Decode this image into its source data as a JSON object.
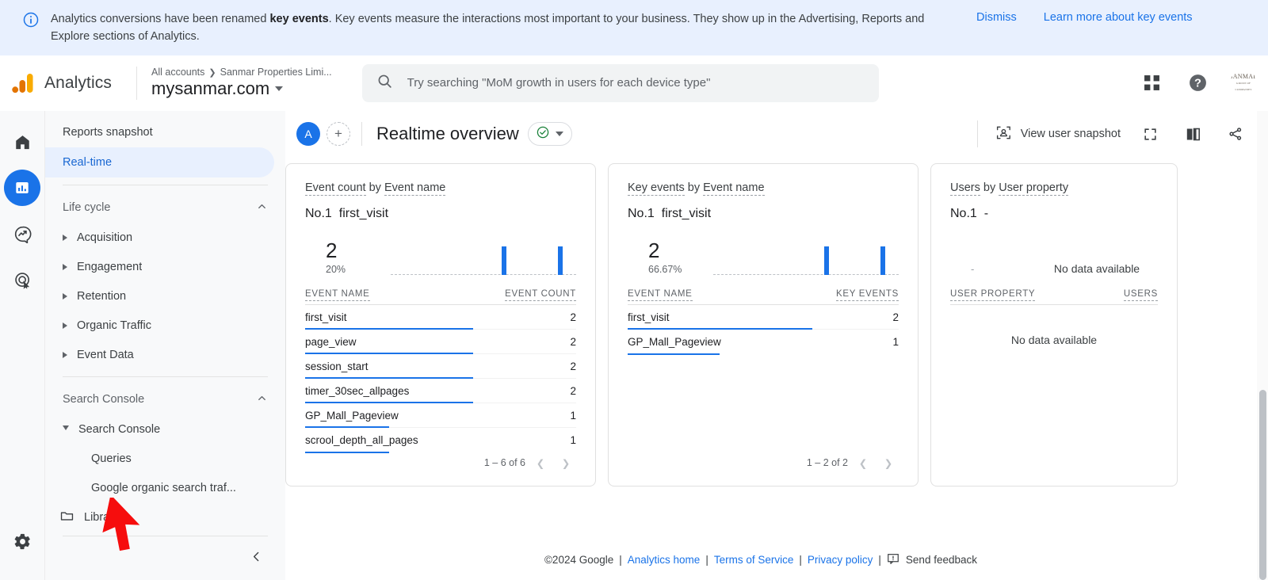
{
  "banner": {
    "icon": "info-icon",
    "text_before": "Analytics conversions have been renamed ",
    "bold": "key events",
    "text_after": ". Key events measure the interactions most important to your business. They show up in the Advertising, Reports and Explore sections of Analytics.",
    "dismiss_label": "Dismiss",
    "learn_more_label": "Learn more about key events"
  },
  "topbar": {
    "product_title": "Analytics",
    "breadcrumb_root": "All accounts",
    "breadcrumb_account": "Sanmar Properties Limi...",
    "property_name": "mysanmar.com",
    "search_placeholder": "Try searching \"MoM growth in users for each device type\"",
    "apps_icon": "apps-grid-icon",
    "help_icon": "help-circle-icon",
    "avatar_label": "SANMAR",
    "avatar_sub": "GROUP OF COMPANIES"
  },
  "rail": {
    "items": [
      {
        "name": "home-icon",
        "label": "Home",
        "active": false
      },
      {
        "name": "reports-icon",
        "label": "Reports",
        "active": true
      },
      {
        "name": "explore-icon",
        "label": "Explore",
        "active": false
      },
      {
        "name": "advertising-icon",
        "label": "Advertising",
        "active": false
      }
    ],
    "settings": {
      "name": "gear-icon",
      "label": "Admin"
    }
  },
  "sidebar": {
    "reports_snapshot": "Reports snapshot",
    "realtime": "Real-time",
    "life_cycle": "Life cycle",
    "life_cycle_items": [
      "Acquisition",
      "Engagement",
      "Retention",
      "Organic Traffic",
      "Event Data"
    ],
    "search_console_group": "Search Console",
    "search_console_item": "Search Console",
    "search_console_children": [
      "Queries",
      "Google organic search traf..."
    ],
    "library": "Library",
    "collapse_icon": "chevron-left-icon"
  },
  "main_header": {
    "avatar_initial": "A",
    "add_label": "+",
    "title": "Realtime overview",
    "status_icon": "check-circle-icon",
    "dropdown_icon": "caret-down-icon",
    "view_user_snapshot": "View user snapshot",
    "fullscreen_icon": "fullscreen-icon",
    "compare_icon": "compare-icon",
    "share_icon": "share-icon"
  },
  "chart_data": [
    {
      "type": "bar",
      "title": "Event count by Event name",
      "title_metric": "Event count",
      "title_dimension": "Event name",
      "rank_label": "No.1",
      "rank_value": "first_visit",
      "metric_value": "2",
      "metric_percent": "20%",
      "sparkline": {
        "points": 30,
        "bars": [
          {
            "index": 18,
            "height": 0.78
          },
          {
            "index": 27,
            "height": 0.78
          }
        ]
      },
      "columns": [
        "EVENT NAME",
        "EVENT COUNT"
      ],
      "categories": [
        "first_visit",
        "page_view",
        "session_start",
        "timer_30sec_allpages",
        "GP_Mall_Pageview",
        "scrool_depth_all_pages"
      ],
      "values": [
        2,
        2,
        2,
        2,
        1,
        1
      ],
      "bar_widths": [
        0.62,
        0.62,
        0.62,
        0.62,
        0.31,
        0.31
      ],
      "pagination": "1 – 6 of 6"
    },
    {
      "type": "bar",
      "title": "Key events by Event name",
      "title_metric": "Key events",
      "title_dimension": "Event name",
      "rank_label": "No.1",
      "rank_value": "first_visit",
      "metric_value": "2",
      "metric_percent": "66.67%",
      "sparkline": {
        "points": 30,
        "bars": [
          {
            "index": 18,
            "height": 0.78
          },
          {
            "index": 27,
            "height": 0.78
          }
        ]
      },
      "columns": [
        "EVENT NAME",
        "KEY EVENTS"
      ],
      "categories": [
        "first_visit",
        "GP_Mall_Pageview"
      ],
      "values": [
        2,
        1
      ],
      "bar_widths": [
        0.68,
        0.34
      ],
      "pagination": "1 – 2 of 2"
    },
    {
      "type": "table",
      "title": "Users by User property",
      "title_metric": "Users",
      "title_dimension": "User property",
      "rank_label": "No.1",
      "rank_value": "-",
      "metric_value": "-",
      "no_data_chart": "No data available",
      "columns": [
        "USER PROPERTY",
        "USERS"
      ],
      "categories": [],
      "values": [],
      "no_data_table": "No data available"
    }
  ],
  "footer": {
    "copyright": "©2024 Google",
    "links": [
      "Analytics home",
      "Terms of Service",
      "Privacy policy"
    ],
    "feedback_label": "Send feedback",
    "feedback_icon": "feedback-icon"
  }
}
